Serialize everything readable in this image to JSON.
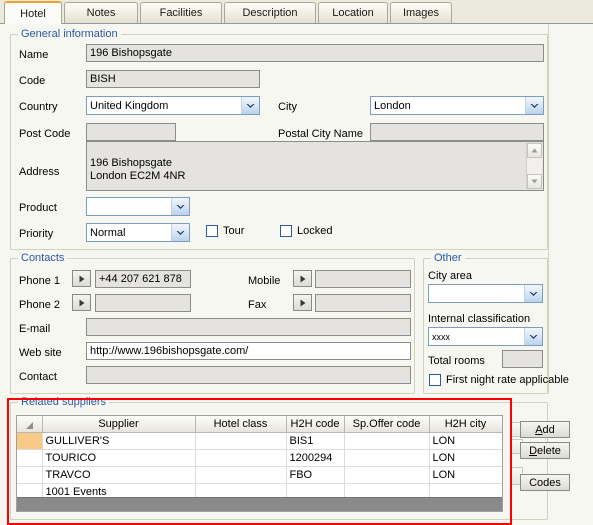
{
  "tabs": [
    {
      "label": "Hotel",
      "active": true
    },
    {
      "label": "Notes",
      "active": false
    },
    {
      "label": "Facilities",
      "active": false
    },
    {
      "label": "Description",
      "active": false
    },
    {
      "label": "Location",
      "active": false
    },
    {
      "label": "Images",
      "active": false
    }
  ],
  "general": {
    "legend": "General information",
    "name_label": "Name",
    "name_value": "196 Bishopsgate",
    "code_label": "Code",
    "code_value": "BISH",
    "country_label": "Country",
    "country_value": "United Kingdom",
    "city_label": "City",
    "city_value": "London",
    "postcode_label": "Post Code",
    "postcode_value": "",
    "postalcity_label": "Postal City Name",
    "postalcity_value": "",
    "address_label": "Address",
    "address_value": "196 Bishopsgate\nLondon EC2M 4NR",
    "product_label": "Product",
    "product_value": "",
    "priority_label": "Priority",
    "priority_value": "Normal",
    "tour_label": "Tour",
    "tour_checked": false,
    "locked_label": "Locked",
    "locked_checked": false
  },
  "contacts": {
    "legend": "Contacts",
    "phone1_label": "Phone 1",
    "phone1_value": "+44 207 621 878",
    "phone2_label": "Phone 2",
    "phone2_value": "",
    "mobile_label": "Mobile",
    "mobile_value": "",
    "fax_label": "Fax",
    "fax_value": "",
    "email_label": "E-mail",
    "email_value": "",
    "website_label": "Web site",
    "website_value": "http://www.196bishopsgate.com/",
    "contact_label": "Contact",
    "contact_value": ""
  },
  "other": {
    "legend": "Other",
    "cityarea_label": "City area",
    "cityarea_value": "",
    "internal_label": "Internal classification",
    "internal_value": "xxxx",
    "totalrooms_label": "Total rooms",
    "totalrooms_value": "",
    "firstnight_label": "First night rate applicable",
    "firstnight_checked": false
  },
  "suppliers": {
    "legend": "Related suppliers",
    "columns": [
      "",
      "Supplier",
      "Hotel class",
      "H2H code",
      "Sp.Offer code",
      "H2H city"
    ],
    "rows": [
      {
        "selected": true,
        "supplier": "GULLIVER'S",
        "hotel_class": "",
        "h2h_code": "BIS1",
        "sp_offer_code": "",
        "h2h_city": "LON"
      },
      {
        "selected": false,
        "supplier": "TOURICO",
        "hotel_class": "",
        "h2h_code": "1200294",
        "sp_offer_code": "",
        "h2h_city": "LON"
      },
      {
        "selected": false,
        "supplier": "TRAVCO",
        "hotel_class": "",
        "h2h_code": "FBO",
        "sp_offer_code": "",
        "h2h_city": "LON"
      },
      {
        "selected": false,
        "supplier": "1001 Events",
        "hotel_class": "",
        "h2h_code": "",
        "sp_offer_code": "",
        "h2h_city": ""
      }
    ],
    "buttons": {
      "add_pre": "",
      "add_mn": "A",
      "add_post": "dd",
      "delete_pre": "",
      "delete_mn": "D",
      "delete_post": "elete",
      "codes": "Codes"
    }
  },
  "colors": {
    "accent_tab": "#f0a030",
    "legend_text": "#2b58a8",
    "highlight_row": "#f7c987",
    "focus_border": "#ff0000"
  }
}
